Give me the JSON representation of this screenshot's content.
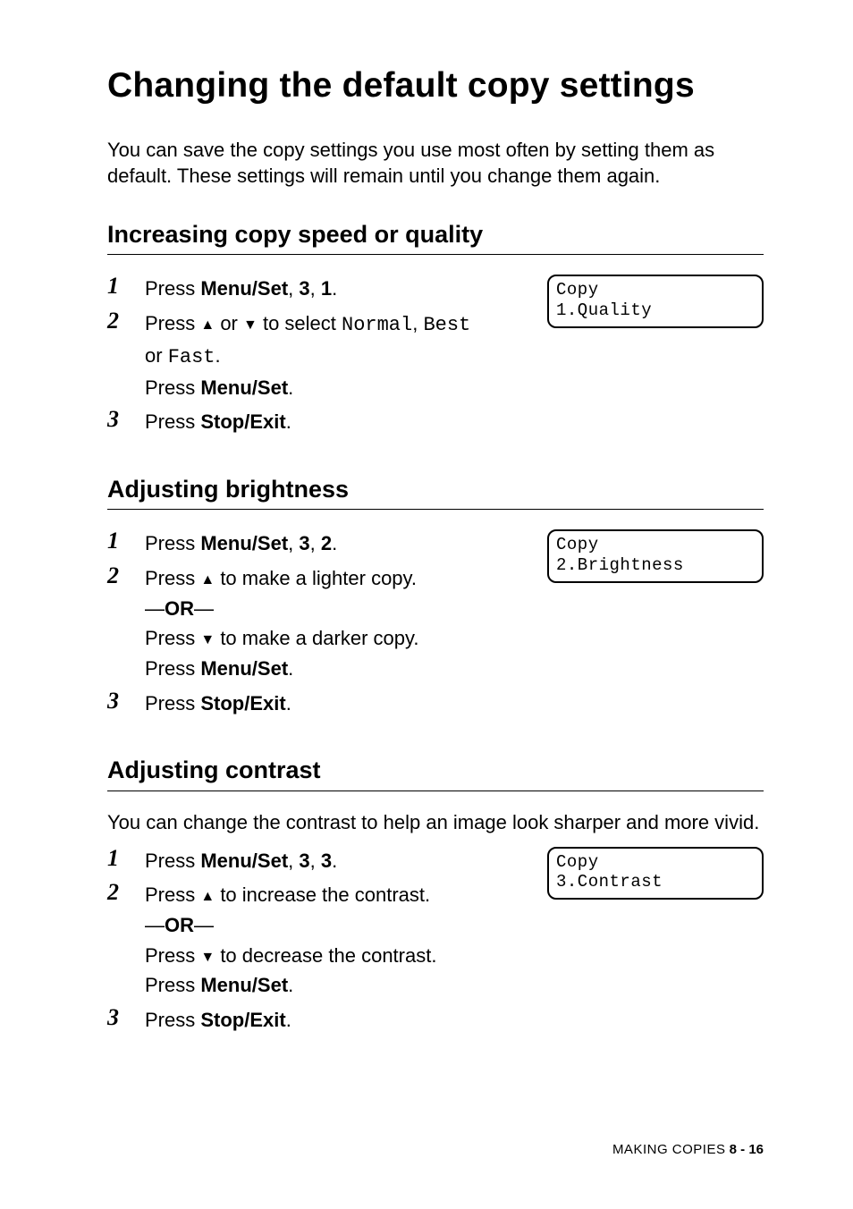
{
  "title": "Changing the default copy settings",
  "intro": "You can save the copy settings you use most often by setting them as default. These settings will remain until you change them again.",
  "sections": {
    "quality": {
      "heading": "Increasing copy speed or quality",
      "display": {
        "line1": "Copy",
        "line2": "1.Quality"
      },
      "step1": {
        "press": "Press ",
        "menuSet": "Menu/Set",
        "comma1": ", ",
        "k1": "3",
        "comma2": ", ",
        "k2": "1",
        "dot": "."
      },
      "step2": {
        "pressA": "Press ",
        "orWord": " or ",
        "toSelect": " to select ",
        "opt1": "Normal",
        "optSep1": ", ",
        "opt2": "Best",
        "orLine": "or ",
        "opt3": "Fast",
        "dot": ".",
        "press2": "Press ",
        "menuSet": "Menu/Set",
        "dot2": "."
      },
      "step3": {
        "press": "Press ",
        "stopExit": "Stop/Exit",
        "dot": "."
      }
    },
    "brightness": {
      "heading": "Adjusting brightness",
      "display": {
        "line1": "Copy",
        "line2": "2.Brightness"
      },
      "step1": {
        "press": "Press ",
        "menuSet": "Menu/Set",
        "comma1": ", ",
        "k1": "3",
        "comma2": ", ",
        "k2": "2",
        "dot": "."
      },
      "step2": {
        "pressA": "Press ",
        "lighter": " to make a lighter copy.",
        "dash1": "—",
        "orWord": "OR",
        "dash2": "—",
        "pressB": "Press ",
        "darker": " to make a darker copy.",
        "press2": "Press ",
        "menuSet": "Menu/Set",
        "dot2": "."
      },
      "step3": {
        "press": "Press ",
        "stopExit": "Stop/Exit",
        "dot": "."
      }
    },
    "contrast": {
      "heading": "Adjusting contrast",
      "introLine": "You can change the contrast to help an image look sharper and more vivid.",
      "display": {
        "line1": "Copy",
        "line2": "3.Contrast"
      },
      "step1": {
        "press": "Press ",
        "menuSet": "Menu/Set",
        "comma1": ", ",
        "k1": "3",
        "comma2": ", ",
        "k2": "3",
        "dot": "."
      },
      "step2": {
        "pressA": "Press ",
        "increase": " to increase the contrast.",
        "dash1": "—",
        "orWord": "OR",
        "dash2": "—",
        "pressB": "Press ",
        "decrease": " to decrease the contrast.",
        "press2": "Press ",
        "menuSet": "Menu/Set",
        "dot2": "."
      },
      "step3": {
        "press": "Press ",
        "stopExit": "Stop/Exit",
        "dot": "."
      }
    }
  },
  "arrows": {
    "up": "▲",
    "down": "▼"
  },
  "stepNumbers": {
    "one": "1",
    "two": "2",
    "three": "3"
  },
  "footer": {
    "label": "MAKING COPIES",
    "page": "8 - 16",
    "gap": "   "
  }
}
